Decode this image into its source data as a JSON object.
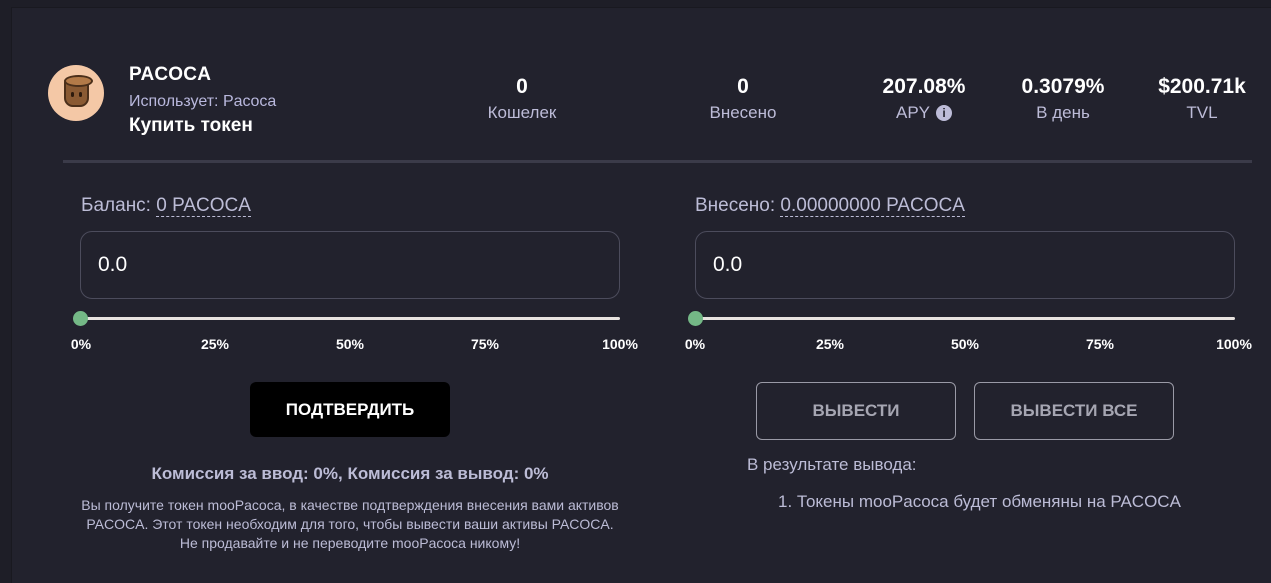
{
  "header": {
    "title": "PACOCA",
    "uses_label": "Использует: Pacoca",
    "buy_label": "Купить токен",
    "logo_icon": "pacoca-cup-logo"
  },
  "stats": [
    {
      "value": "0",
      "label": "Кошелек"
    },
    {
      "value": "0",
      "label": "Внесено"
    },
    {
      "value": "207.08%",
      "label": "APY",
      "icon": "info-icon"
    },
    {
      "value": "0.3079%",
      "label": "В день"
    },
    {
      "value": "$200.71k",
      "label": "TVL"
    }
  ],
  "deposit": {
    "balance_prefix": "Баланс:",
    "balance_value": "0 PACOCA",
    "input_value": "0.0",
    "slider_value": 0,
    "ticks": [
      "0%",
      "25%",
      "50%",
      "75%",
      "100%"
    ],
    "confirm_label": "ПОДТВЕРДИТЬ",
    "fees": "Комиссия за ввод: 0%, Комиссия за вывод: 0%",
    "note": "Вы получите токен mooPacoca, в качестве подтверждения внесения вами активов PACOCA. Этот токен необходим для того, чтобы вывести ваши активы PACOCA. Не продавайте и не переводите mooPacoca никому!"
  },
  "withdraw": {
    "deposited_prefix": "Внесено:",
    "deposited_value": "0.00000000 PACOCA",
    "input_value": "0.0",
    "slider_value": 0,
    "ticks": [
      "0%",
      "25%",
      "50%",
      "75%",
      "100%"
    ],
    "withdraw_label": "ВЫВЕСТИ",
    "withdraw_all_label": "ВЫВЕСТИ ВСЕ",
    "result_title": "В результате вывода:",
    "result_item": "1. Токены mooPacoca будет обменяны на PACOCA"
  },
  "colors": {
    "background": "#22222d",
    "accent_green": "#74b886",
    "muted_text": "#bcbcd6"
  }
}
